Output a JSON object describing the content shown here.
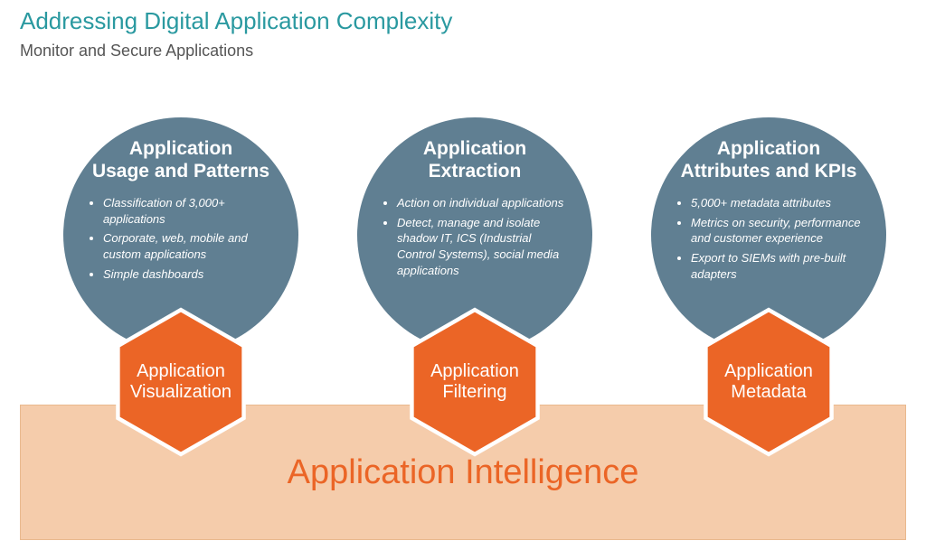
{
  "title": "Addressing Digital Application Complexity",
  "subtitle": "Monitor and Secure Applications",
  "base_label": "Application Intelligence",
  "columns": [
    {
      "circle_title": "Application\nUsage and Patterns",
      "bullets": [
        "Classification of 3,000+ applications",
        "Corporate, web, mobile and custom applications",
        "Simple dashboards"
      ],
      "hex_label": "Application\nVisualization"
    },
    {
      "circle_title": "Application\nExtraction",
      "bullets": [
        "Action on individual applications",
        "Detect, manage and isolate shadow IT, ICS (Industrial Control Systems), social media applications"
      ],
      "hex_label": "Application\nFiltering"
    },
    {
      "circle_title": "Application\nAttributes and KPIs",
      "bullets": [
        "5,000+ metadata attributes",
        "Metrics on security, performance and customer experience",
        "Export to SIEMs with pre-built adapters"
      ],
      "hex_label": "Application\nMetadata"
    }
  ],
  "colors": {
    "title": "#2a99a0",
    "circle": "#607f92",
    "hex_fill": "#eb6526",
    "hex_stroke": "#ffffff",
    "band_fill": "#f5ccab",
    "band_stroke": "#e9b98e"
  }
}
